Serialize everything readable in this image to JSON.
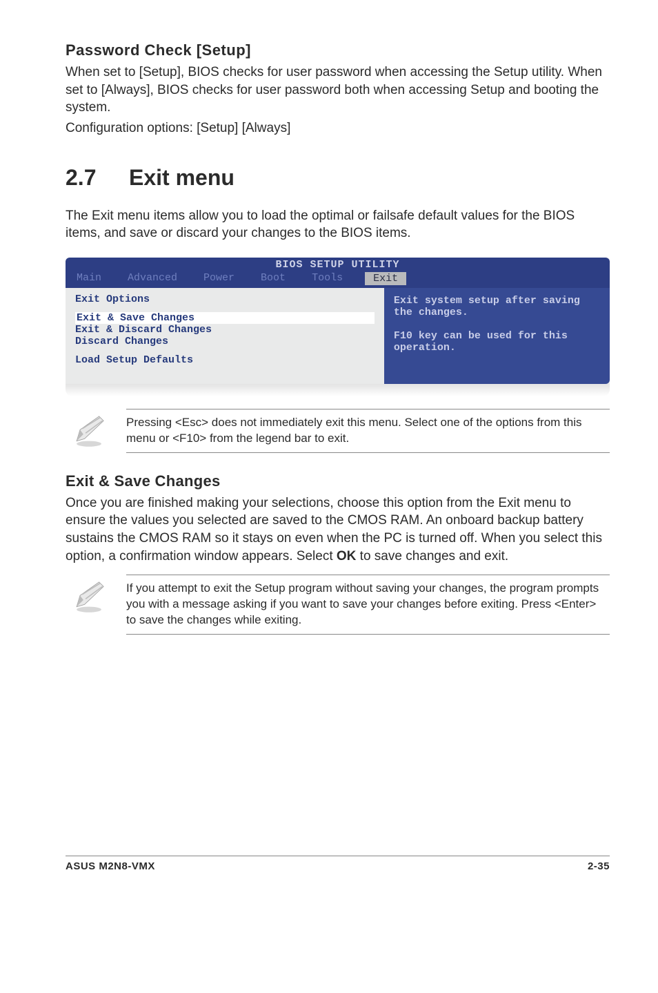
{
  "password_check": {
    "title": "Password Check [Setup]",
    "body": "When set to [Setup], BIOS checks for user password when accessing the Setup utility. When set to [Always], BIOS checks for user password both when accessing Setup and booting the system.",
    "config": "Configuration options: [Setup] [Always]"
  },
  "section": {
    "num": "2.7",
    "title": "Exit menu"
  },
  "intro": "The Exit menu items allow you to load the optimal or failsafe default values for the BIOS items, and save or discard your changes to the BIOS items.",
  "bios": {
    "title": "BIOS SETUP UTILITY",
    "tabs": {
      "main": "Main",
      "advanced": "Advanced",
      "power": "Power",
      "boot": "Boot",
      "tools": "Tools",
      "exit": "Exit"
    },
    "left_title": "Exit Options",
    "opts": {
      "save": "Exit & Save Changes",
      "discard": "Exit & Discard Changes",
      "discard_only": "Discard Changes",
      "defaults": "Load Setup Defaults"
    },
    "help": "Exit system setup after saving the changes.\n\nF10 key can be used for this operation."
  },
  "note1": "Pressing <Esc> does not immediately exit this menu. Select one of the options from this menu or <F10> from the legend bar to exit.",
  "exit_save": {
    "title": "Exit & Save Changes",
    "body_pre": "Once you are finished making your selections, choose this option from the Exit menu to ensure the values you selected are saved to the CMOS RAM. An onboard backup battery sustains the CMOS RAM so it stays on even when the PC is turned off. When you select this option, a confirmation window appears. Select ",
    "ok": "OK",
    "body_post": " to save changes and exit."
  },
  "note2": " If you attempt to exit the Setup program without saving your changes, the program prompts you with a message asking if you want to save your changes before exiting. Press <Enter>  to save the  changes while exiting.",
  "footer": {
    "left": "ASUS M2N8-VMX",
    "right": "2-35"
  }
}
